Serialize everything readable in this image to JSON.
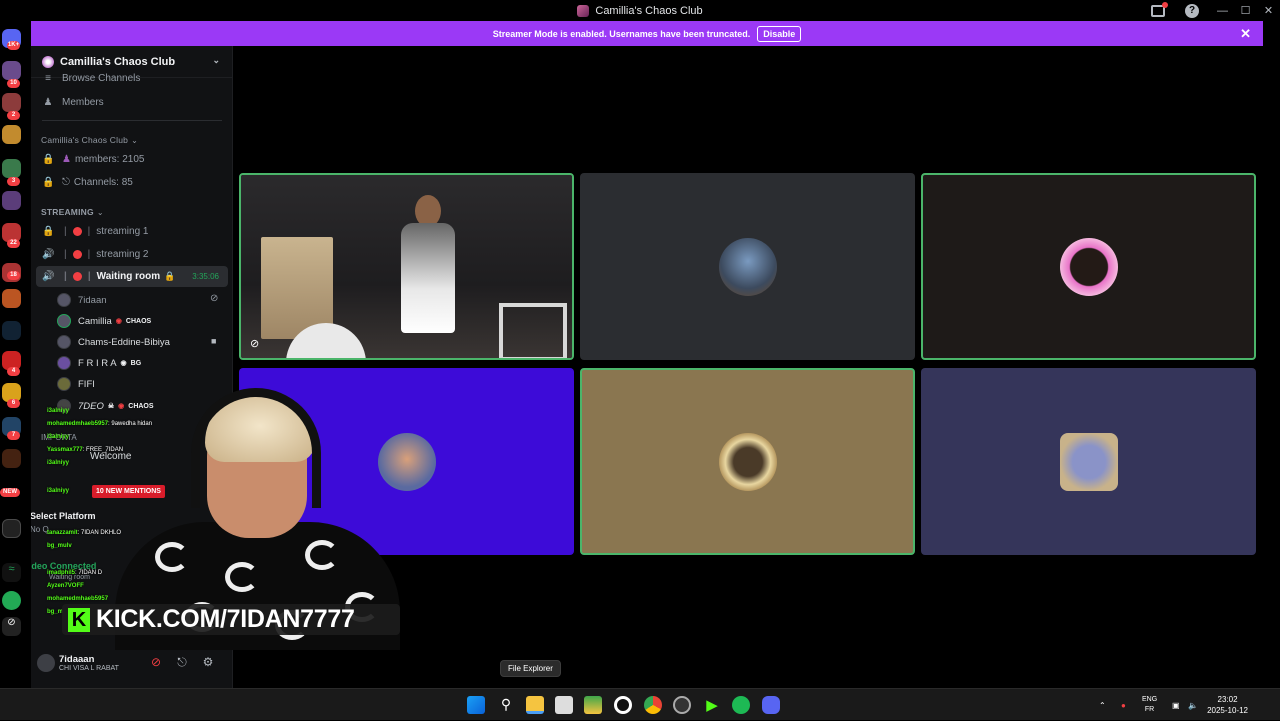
{
  "window": {
    "title": "Camillia's Chaos Club"
  },
  "banner": {
    "text": "Streamer Mode is enabled. Usernames have been truncated.",
    "disable_label": "Disable",
    "close_icon": "close-icon"
  },
  "server_rail": {
    "badges": [
      "1K+",
      "10",
      "2",
      "3",
      "22",
      "18",
      "4",
      "6",
      "7",
      "NEW"
    ]
  },
  "sidebar": {
    "server_name": "Camillia's Chaos Club",
    "browse_channels": "Browse Channels",
    "members_label": "Members",
    "stats_category": "Camillia's Chaos Club",
    "stat_members": "members: 2105",
    "stat_channels": "Channels: 85",
    "streaming_category": "STREAMING",
    "channels": [
      {
        "name": "streaming 1"
      },
      {
        "name": "streaming 2"
      },
      {
        "name": "Waiting room",
        "timer": "3:35:06"
      }
    ],
    "voice_users": [
      {
        "name": "7idaan",
        "tag": ""
      },
      {
        "name": "Camillia",
        "tag": "CHAOS"
      },
      {
        "name": "Chams-Eddine-Bibiya",
        "tag": ""
      },
      {
        "name": "F R I R A",
        "tag": "BG"
      },
      {
        "name": "FIFI",
        "tag": ""
      },
      {
        "name": "7DEO",
        "tag": "CHAOS"
      }
    ],
    "partial_rows": [
      "IMPORTA",
      "Welcome",
      "10 NEW MENTIONS",
      "Select Platform",
      "No Q",
      "Video Connected",
      "Waiting room"
    ]
  },
  "user_panel": {
    "name": "7idaaan",
    "status": "CHI VISA L RABAT"
  },
  "stream_overlay": {
    "kick_url": "KICK.COM/7IDAN7777",
    "chat": [
      {
        "user": "i3alniyy",
        "msg": ""
      },
      {
        "user": "mohamedmhaeb5957",
        "msg": ": 9awedha hidan"
      },
      {
        "user": "i3alniyy",
        "msg": ""
      },
      {
        "user": "Yassmax777",
        "msg": ": FREE_7IDAN"
      },
      {
        "user": "i3alniyy",
        "msg": ""
      },
      {
        "user": "i3alniyy",
        "msg": ""
      },
      {
        "user": "tanazzamit",
        "msg": ": 7IDAN DKHLO"
      },
      {
        "user": "bg_mulv",
        "msg": ""
      },
      {
        "user": "imadphil5",
        "msg": ": 7IDAN D"
      },
      {
        "user": "Ayzen7VOFF",
        "msg": ""
      },
      {
        "user": "mohamedmhaeb5957",
        "msg": ""
      },
      {
        "user": "bg_m",
        "msg": ""
      }
    ]
  },
  "tooltip": "File Explorer",
  "tray": {
    "lang_top": "ENG",
    "lang_bottom": "FR",
    "time": "23:02",
    "date": "2025-10-12"
  },
  "colors": {
    "accent": "#9b39f6",
    "speaking": "#4bb56a",
    "tile_blue": "#3d0bd8",
    "tile_gold": "#8a7650",
    "tile_slate": "#35355a"
  }
}
